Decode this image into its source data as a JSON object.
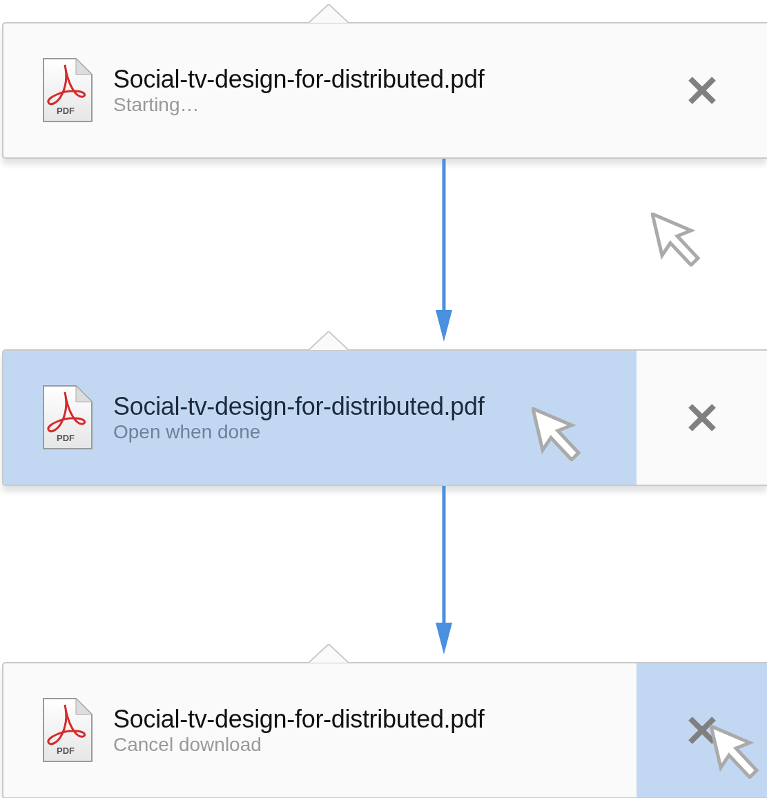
{
  "panels": [
    {
      "file_type": "PDF",
      "filename": "Social-tv-design-for-distributed.pdf",
      "status": "Starting…",
      "row_hovered": false,
      "close_hovered": false
    },
    {
      "file_type": "PDF",
      "filename": "Social-tv-design-for-distributed.pdf",
      "status": "Open when done",
      "row_hovered": true,
      "close_hovered": false
    },
    {
      "file_type": "PDF",
      "filename": "Social-tv-design-for-distributed.pdf",
      "status": "Cancel download",
      "row_hovered": false,
      "close_hovered": true
    }
  ]
}
